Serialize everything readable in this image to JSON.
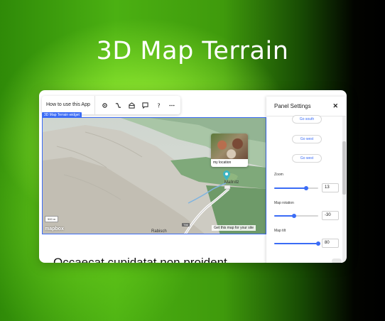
{
  "hero": {
    "title": "3D Map Terrain"
  },
  "toolbar": {
    "help_label": "How to use this App",
    "icons": [
      "gear-icon",
      "connect-icon",
      "upgrade-icon",
      "comment-icon",
      "help-icon",
      "more-icon"
    ]
  },
  "widget_tag": "3D Map Terrain widget",
  "map": {
    "photo_caption": "my location",
    "town_label": "Mallnitz",
    "lower_town_label": "Rabisch",
    "road_shield": "T66",
    "scale_label": "500 m",
    "attribution": "mapbox",
    "link_text": "Get this map for your site",
    "marker_color": "#3cb4c2",
    "selection_color": "#3b6cf6"
  },
  "content": {
    "heading": "Occaecat cupidatat non proident"
  },
  "panel": {
    "title": "Panel Settings",
    "buttons": {
      "go_south": "Go south",
      "go_west_1": "Go west",
      "go_west_2": "Go west"
    },
    "zoom": {
      "label": "Zoom",
      "value": "13",
      "fraction": 0.73
    },
    "rotation": {
      "label": "Map rotation",
      "value": "-30",
      "fraction": 0.45
    },
    "tilt": {
      "label": "Map tilt",
      "value": "80",
      "fraction": 1.0
    },
    "accent_color": "#3b6cf6"
  }
}
